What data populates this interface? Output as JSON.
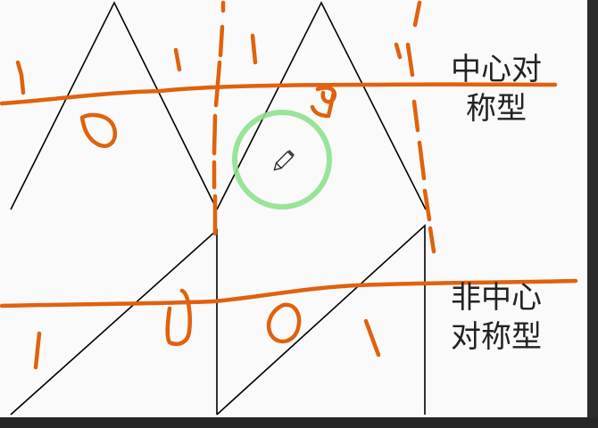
{
  "canvas": {
    "background": "#fafafa",
    "stroke_color": "#000000",
    "annotation_color": "#e0610e",
    "highlight_color": "#8fe08f"
  },
  "labels": {
    "top_line1": "中心对",
    "top_line2": "称型",
    "bottom_line1": "非中心",
    "bottom_line2": "对称型"
  },
  "handwritten_marks": {
    "top_row": [
      "1",
      "0",
      "1",
      "1",
      "9",
      "1"
    ],
    "bottom_row": [
      "1",
      "0",
      "0",
      "1"
    ]
  },
  "cursor": {
    "icon": "pencil-icon"
  }
}
